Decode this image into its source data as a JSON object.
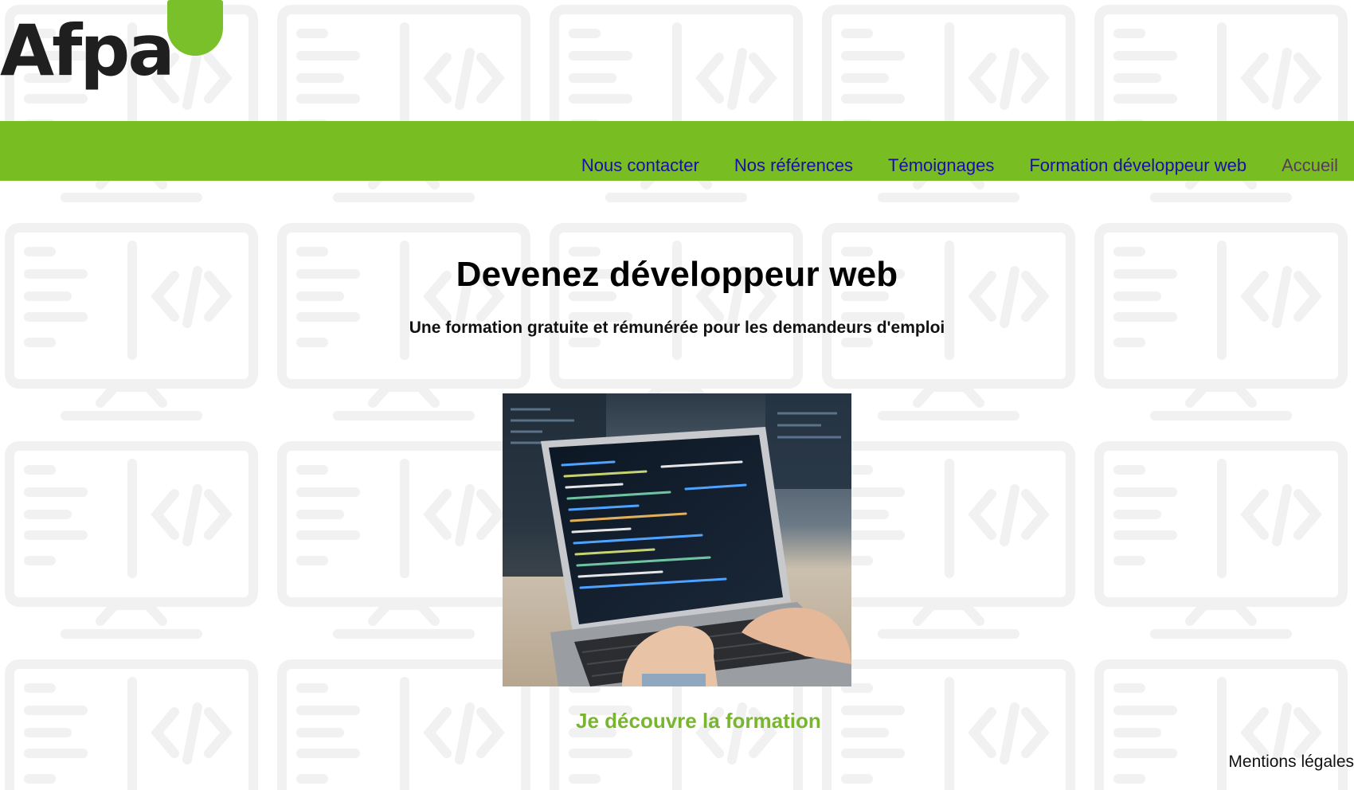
{
  "logo": {
    "text": "Afpa",
    "brand_color": "#78bd22"
  },
  "nav": {
    "items": [
      {
        "label": "Nous contacter"
      },
      {
        "label": "Nos références"
      },
      {
        "label": "Témoignages"
      },
      {
        "label": "Formation développeur web"
      },
      {
        "label": "Accueil"
      }
    ]
  },
  "hero": {
    "title": "Devenez développeur web",
    "subtitle": "Une formation gratuite et rémunérée pour les demandeurs d'emploi",
    "image_icon": "laptop-with-code-photo",
    "cta_label": "Je découvre la formation"
  },
  "footer": {
    "legal_label": "Mentions légales"
  },
  "colors": {
    "nav_bar": "#78bd22",
    "link": "#1a0dab",
    "visited_link": "#5a3a63",
    "cta": "#79b530",
    "background_pattern": "#f1f1f1"
  }
}
